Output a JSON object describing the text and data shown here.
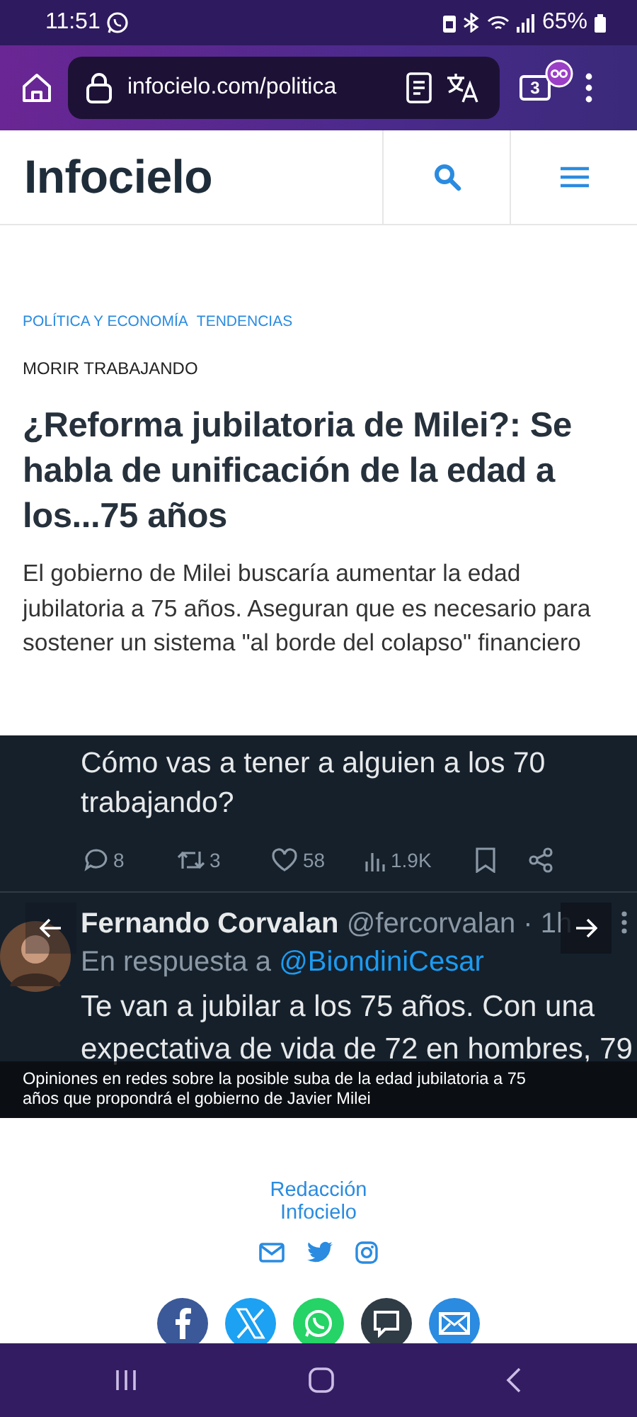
{
  "status_bar": {
    "time": "11:51",
    "battery": "65%"
  },
  "browser": {
    "url": "infocielo.com/politica",
    "tab_count": "3"
  },
  "site": {
    "logo": "Infocielo"
  },
  "article": {
    "categories": [
      "POLÍTICA Y ECONOMÍA",
      "TENDENCIAS"
    ],
    "kicker": "MORIR TRABAJANDO",
    "title": "¿Reforma jubilatoria de Milei?: Se habla de unificación de la edad a los...75 años",
    "summary": "El gobierno de Milei buscaría aumentar la edad jubilatoria a 75 años. Aseguran que es necesario para sostener un sistema \"al borde del colapso\" financiero"
  },
  "image": {
    "tweet_text": "Cómo vas a tener a alguien a los 70 trabajando?",
    "stats": [
      {
        "kind": "reply",
        "count": "8"
      },
      {
        "kind": "retweet",
        "count": "3"
      },
      {
        "kind": "like",
        "count": "58"
      },
      {
        "kind": "views",
        "count": "1.9K"
      },
      {
        "kind": "bookmark"
      },
      {
        "kind": "share"
      }
    ],
    "reply": {
      "name": "Fernando Corvalan",
      "handle": "@fercorvalan · 1h",
      "reply_prefix": "En respuesta a",
      "reply_to": "@BiondiniCesar",
      "text": "Te van a jubilar a los 75 años. Con una expectativa de vida de 72 en hombres, 79"
    },
    "caption": "Opiniones en redes sobre la posible suba de la edad jubilatoria a 75 años que propondrá el gobierno de Javier Milei"
  },
  "author": {
    "name": "Redacción Infocielo",
    "links": [
      {
        "kind": "email"
      },
      {
        "kind": "twitter"
      },
      {
        "kind": "instagram"
      }
    ]
  },
  "share": [
    {
      "kind": "facebook",
      "color": "#3b5998"
    },
    {
      "kind": "x",
      "color": "#1da1f2"
    },
    {
      "kind": "whatsapp",
      "color": "#25d366"
    },
    {
      "kind": "sms",
      "color": "#2f3b45"
    },
    {
      "kind": "email",
      "color": "#2a8be0"
    }
  ]
}
